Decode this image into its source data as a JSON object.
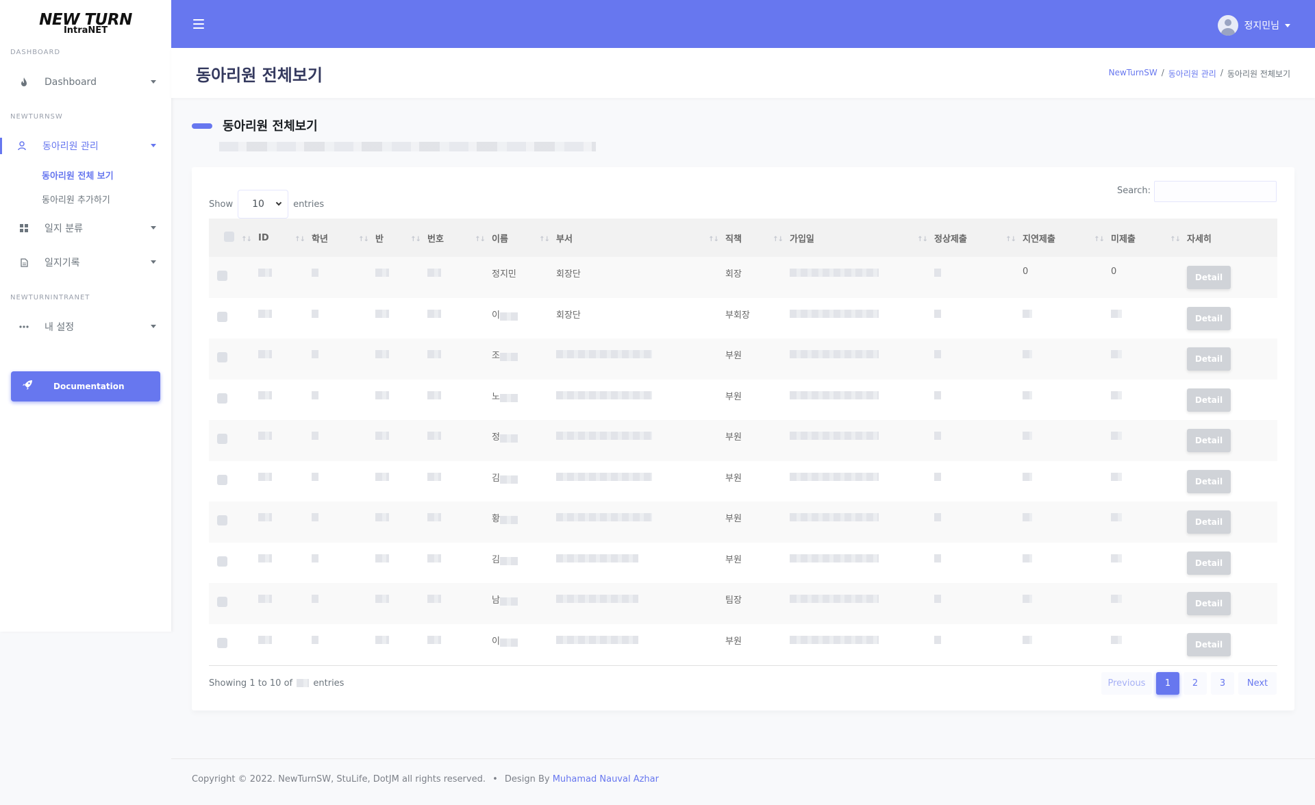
{
  "logo": {
    "line1": "NEW TURN",
    "line2": "IntraNET"
  },
  "sidebar": {
    "sections": [
      "DASHBOARD",
      "NEWTURNSW",
      "NEWTURNINTRANET"
    ],
    "items": [
      {
        "label": "Dashboard",
        "icon": "fire-icon"
      },
      {
        "label": "동아리원 관리",
        "icon": "user-icon"
      },
      {
        "label": "일지 분류",
        "icon": "grid-icon"
      },
      {
        "label": "일지기록",
        "icon": "file-icon"
      },
      {
        "label": "내 설정",
        "icon": "ellipsis-icon"
      }
    ],
    "subitems": [
      "동아리원 전체 보기",
      "동아리원 추가하기"
    ],
    "documentation": "Documentation"
  },
  "topbar": {
    "user_name": "정지민님"
  },
  "header": {
    "title": "동아리원 전체보기",
    "breadcrumb": [
      "NewTurnSW",
      "동아리원 관리",
      "동아리원 전체보기"
    ]
  },
  "section": {
    "title": "동아리원 전체보기"
  },
  "table_controls": {
    "show": "Show",
    "entries": "entries",
    "page_length": "10",
    "search_label": "Search:"
  },
  "table": {
    "headers": [
      "ID",
      "학년",
      "반",
      "번호",
      "이름",
      "부서",
      "직책",
      "가입일",
      "정상제출",
      "지연제출",
      "미제출",
      "자세히"
    ],
    "rows": [
      {
        "name": "정지민",
        "dept": "회장단",
        "role": "회장",
        "late": "0",
        "missing": "0"
      },
      {
        "name": "이",
        "dept": "회장단",
        "role": "부회장",
        "late": "",
        "missing": ""
      },
      {
        "name": "조",
        "dept": "",
        "role": "부원",
        "late": "",
        "missing": ""
      },
      {
        "name": "노",
        "dept": "",
        "role": "부원",
        "late": "",
        "missing": ""
      },
      {
        "name": "정",
        "dept": "",
        "role": "부원",
        "late": "",
        "missing": ""
      },
      {
        "name": "김",
        "dept": "",
        "role": "부원",
        "late": "",
        "missing": ""
      },
      {
        "name": "황",
        "dept": "",
        "role": "부원",
        "late": "",
        "missing": ""
      },
      {
        "name": "김",
        "dept": "",
        "role": "부원",
        "late": "",
        "missing": ""
      },
      {
        "name": "남",
        "dept": "",
        "role": "팀장",
        "late": "",
        "missing": ""
      },
      {
        "name": "이",
        "dept": "",
        "role": "부원",
        "late": "",
        "missing": ""
      }
    ],
    "detail_label": "Detail"
  },
  "info": {
    "prefix": "Showing 1 to 10 of",
    "suffix": "entries"
  },
  "pagination": {
    "previous": "Previous",
    "pages": [
      "1",
      "2",
      "3"
    ],
    "next": "Next"
  },
  "footer": {
    "copyright": "Copyright © 2022. NewTurnSW, StuLife, DotJM all rights reserved.",
    "bullet": "•",
    "design_by": "Design By",
    "author": "Muhamad Nauval Azhar"
  },
  "colors": {
    "primary": "#6777ef",
    "title": "#34395e",
    "disabled_button": "#d0d3d8"
  }
}
